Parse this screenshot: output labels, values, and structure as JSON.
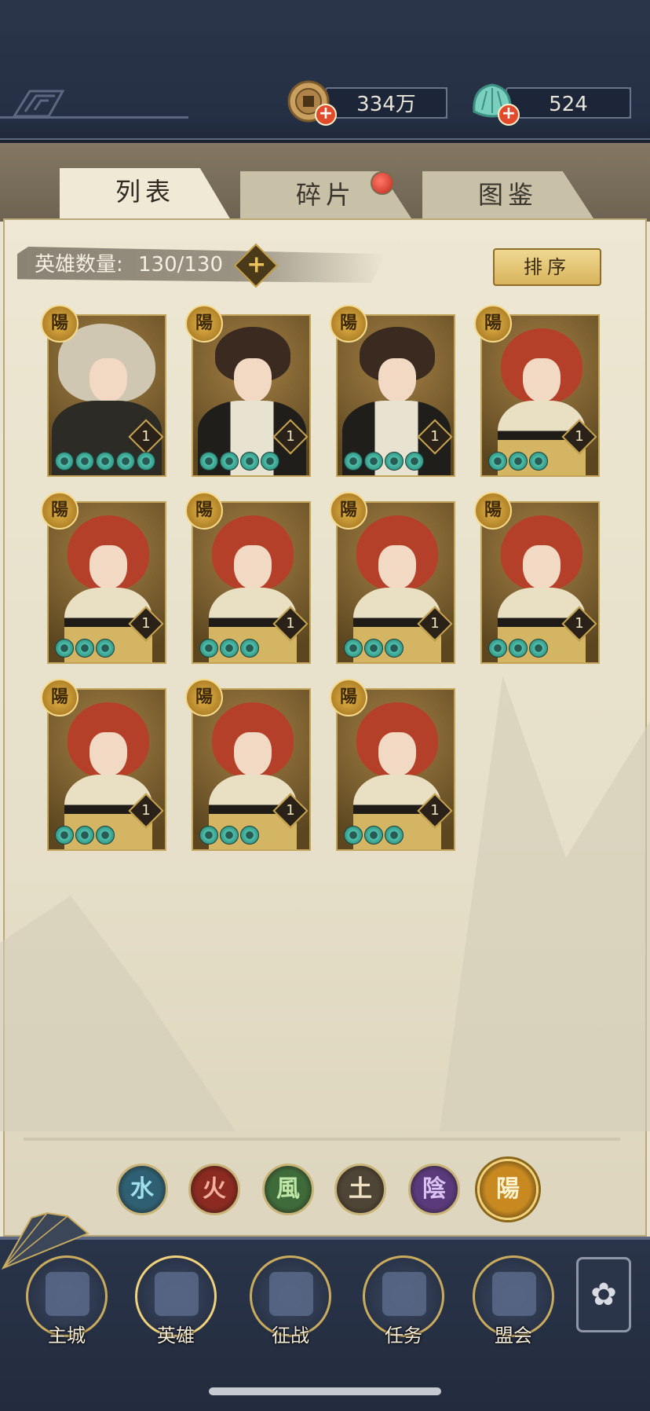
{
  "header": {
    "coins": {
      "value": "334万",
      "icon": "copper-coin-icon"
    },
    "gems": {
      "value": "524",
      "icon": "jade-shell-icon"
    }
  },
  "tabs": [
    {
      "label": "列表",
      "active": true
    },
    {
      "label": "碎片",
      "active": false,
      "badge": true
    },
    {
      "label": "图鉴",
      "active": false
    }
  ],
  "hero_count": {
    "label": "英雄数量:",
    "value": "130/130"
  },
  "sort_button": "排序",
  "hero_badge_glyph": "陽",
  "heroes": [
    {
      "type": "pale",
      "level": "1",
      "stars": 5
    },
    {
      "type": "dark",
      "level": "1",
      "stars": 4
    },
    {
      "type": "dark",
      "level": "1",
      "stars": 4
    },
    {
      "type": "red",
      "level": "1",
      "stars": 3
    },
    {
      "type": "red",
      "level": "1",
      "stars": 3
    },
    {
      "type": "red",
      "level": "1",
      "stars": 3
    },
    {
      "type": "red",
      "level": "1",
      "stars": 3
    },
    {
      "type": "red",
      "level": "1",
      "stars": 3
    },
    {
      "type": "red",
      "level": "1",
      "stars": 3
    },
    {
      "type": "red",
      "level": "1",
      "stars": 3
    },
    {
      "type": "red",
      "level": "1",
      "stars": 3
    }
  ],
  "element_filters": [
    {
      "glyph": "水",
      "color": "#2f5f72",
      "fg": "#9fe0ea",
      "selected": false
    },
    {
      "glyph": "火",
      "color": "#8a2a20",
      "fg": "#f3b09c",
      "selected": false
    },
    {
      "glyph": "風",
      "color": "#3f6a3a",
      "fg": "#bfe6a6",
      "selected": false
    },
    {
      "glyph": "土",
      "color": "#4f4536",
      "fg": "#f1e2c3",
      "selected": false
    },
    {
      "glyph": "陰",
      "color": "#5b3a7c",
      "fg": "#d9c1f2",
      "selected": false
    },
    {
      "glyph": "陽",
      "color": "#c88a20",
      "fg": "#fff2cf",
      "selected": true
    }
  ],
  "bottom_nav": [
    {
      "label": "主城",
      "icon": "city-gate-icon"
    },
    {
      "label": "英雄",
      "icon": "hero-portrait-icon",
      "active": true
    },
    {
      "label": "征战",
      "icon": "battle-helmet-icon"
    },
    {
      "label": "任务",
      "icon": "task-scroll-icon"
    },
    {
      "label": "盟会",
      "icon": "alliance-gate-icon"
    }
  ],
  "menu_icon": "flower-menu-icon"
}
